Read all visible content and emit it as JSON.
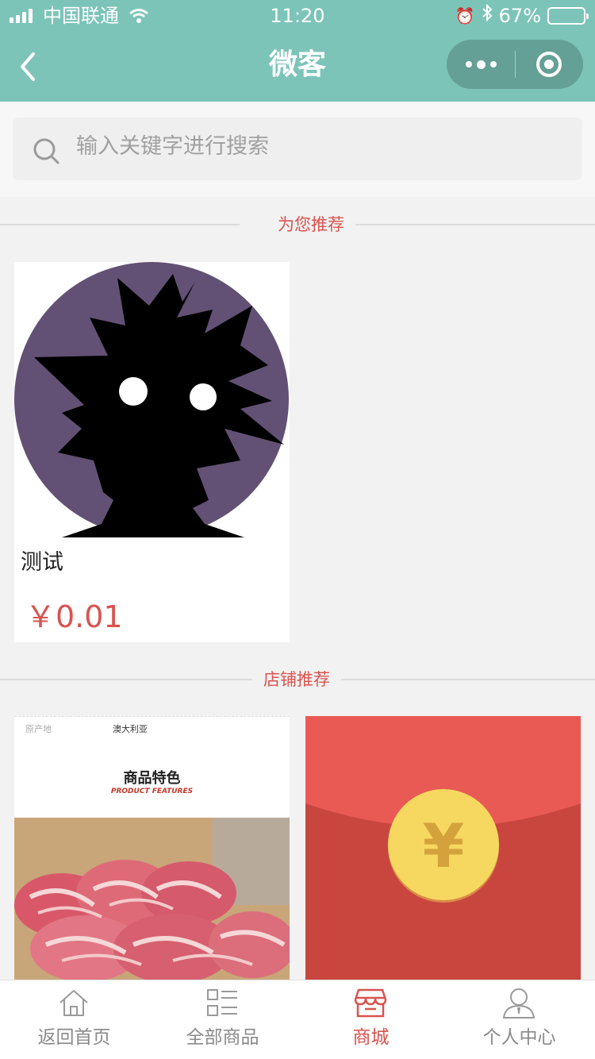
{
  "status_bar": {
    "carrier": "中国联通",
    "time": "11:20",
    "battery": "67%",
    "battery_level": 0.67
  },
  "nav": {
    "title": "微客"
  },
  "search": {
    "placeholder": "输入关键字进行搜索"
  },
  "sections": {
    "recommended_title": "为您推荐",
    "shop_title": "店铺推荐"
  },
  "recommended": {
    "items": [
      {
        "name": "测试",
        "price": "￥0.01"
      }
    ]
  },
  "shop": {
    "items": [
      {
        "origin_label": "原产地",
        "origin_value": "澳大利亚",
        "feature_title": "商品特色",
        "feature_subtitle": "PRODUCT FEATURES"
      },
      {
        "symbol": "¥"
      }
    ]
  },
  "tabs": [
    {
      "label": "返回首页",
      "icon": "home-icon"
    },
    {
      "label": "全部商品",
      "icon": "list-icon"
    },
    {
      "label": "商城",
      "icon": "store-icon",
      "active": true
    },
    {
      "label": "个人中心",
      "icon": "user-icon"
    }
  ],
  "colors": {
    "header": "#7cc4b8",
    "accent": "#d9534f",
    "avatar_bg": "#625175",
    "red_packet": "#d9534f",
    "coin": "#f6d860"
  }
}
